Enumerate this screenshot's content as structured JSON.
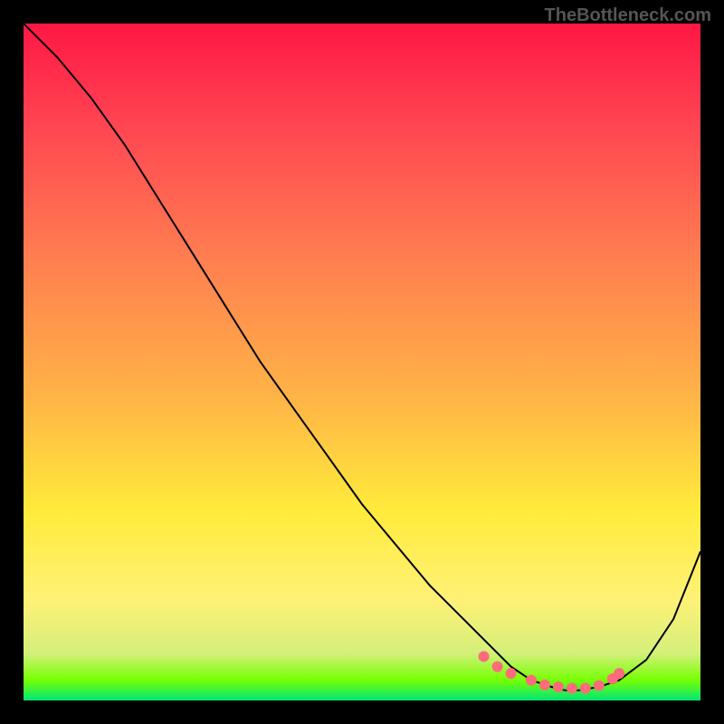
{
  "watermark": "TheBottleneck.com",
  "chart_data": {
    "type": "line",
    "title": "",
    "xlabel": "",
    "ylabel": "",
    "xlim": [
      0,
      100
    ],
    "ylim": [
      0,
      100
    ],
    "gradient_stops": [
      {
        "offset": 0,
        "color": "#ff1744"
      },
      {
        "offset": 15,
        "color": "#ff4552"
      },
      {
        "offset": 35,
        "color": "#ff7f50"
      },
      {
        "offset": 55,
        "color": "#ffb347"
      },
      {
        "offset": 72,
        "color": "#ffeb3b"
      },
      {
        "offset": 85,
        "color": "#fff176"
      },
      {
        "offset": 93,
        "color": "#d4f07a"
      },
      {
        "offset": 97,
        "color": "#76ff03"
      },
      {
        "offset": 100,
        "color": "#00e676"
      }
    ],
    "series": [
      {
        "name": "bottleneck-curve",
        "x": [
          0,
          5,
          10,
          15,
          20,
          25,
          30,
          35,
          40,
          45,
          50,
          55,
          60,
          65,
          70,
          72,
          75,
          78,
          80,
          82,
          85,
          88,
          92,
          96,
          100
        ],
        "y": [
          100,
          95,
          89,
          82,
          74,
          66,
          58,
          50,
          43,
          36,
          29,
          23,
          17,
          12,
          7,
          5,
          3,
          2,
          1.5,
          1.5,
          2,
          3,
          6,
          12,
          22
        ]
      }
    ],
    "highlight_points": {
      "name": "highlight-dots",
      "color": "#ff6b7a",
      "x": [
        68,
        70,
        72,
        75,
        77,
        79,
        81,
        83,
        85,
        87,
        88
      ],
      "y": [
        6.5,
        5,
        4,
        3,
        2.3,
        2,
        1.8,
        1.8,
        2.2,
        3.2,
        4
      ]
    }
  }
}
